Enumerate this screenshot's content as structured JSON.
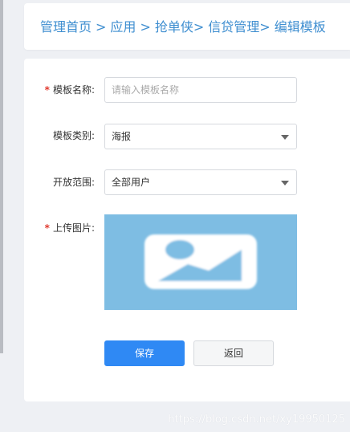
{
  "breadcrumb": {
    "items": [
      "管理首页",
      "应用",
      "抢单侠",
      "信贷管理",
      "编辑模板"
    ],
    "separator": ">"
  },
  "form": {
    "name": {
      "label": "模板名称:",
      "required": true,
      "value": "",
      "placeholder": "请输入模板名称"
    },
    "category": {
      "label": "模板类别:",
      "selected": "海报"
    },
    "scope": {
      "label": "开放范围:",
      "selected": "全部用户"
    },
    "image": {
      "label": "上传图片:",
      "required": true,
      "icon": "image-placeholder-icon"
    }
  },
  "actions": {
    "save_label": "保存",
    "back_label": "返回"
  },
  "watermark": "https://blog.csdn.net/xy19950125",
  "colors": {
    "link": "#3e8ed0",
    "primary": "#2f89f4",
    "required": "#e0382d",
    "upload_bg": "#7ebde3"
  }
}
